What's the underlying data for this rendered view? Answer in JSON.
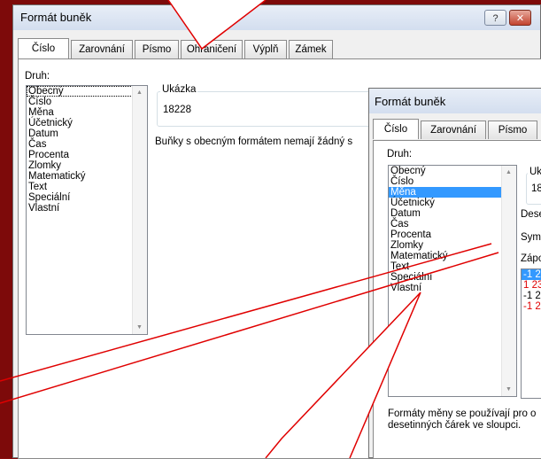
{
  "dialog1": {
    "title": "Formát buněk",
    "help_label": "?",
    "close_label": "✕",
    "tabs": [
      {
        "label": "Číslo"
      },
      {
        "label": "Zarovnání"
      },
      {
        "label": "Písmo"
      },
      {
        "label": "Ohraničení"
      },
      {
        "label": "Výplň"
      },
      {
        "label": "Zámek"
      }
    ],
    "category_label": "Druh:",
    "categories": [
      "Obecný",
      "Číslo",
      "Měna",
      "Účetnický",
      "Datum",
      "Čas",
      "Procenta",
      "Zlomky",
      "Matematický",
      "Text",
      "Speciální",
      "Vlastní"
    ],
    "sample_label": "Ukázka",
    "sample_value": "18228",
    "description": "Buňky s obecným formátem nemají žádný s"
  },
  "dialog2": {
    "title": "Formát buněk",
    "tabs": [
      {
        "label": "Číslo"
      },
      {
        "label": "Zarovnání"
      },
      {
        "label": "Písmo"
      }
    ],
    "category_label": "Druh:",
    "categories": [
      "Obecný",
      "Číslo",
      "Měna",
      "Účetnický",
      "Datum",
      "Čas",
      "Procenta",
      "Zlomky",
      "Matematický",
      "Text",
      "Speciální",
      "Vlastní"
    ],
    "sample_label": "Uká",
    "sample_value": "18",
    "decimal_label": "Dese",
    "symbol_label": "Symb",
    "negative_label": "Zápo",
    "negatives": [
      {
        "text": "-1 2",
        "color": "#ffffff"
      },
      {
        "text": "1 23",
        "color": "#e00000"
      },
      {
        "text": "-1 2",
        "color": "#000000"
      },
      {
        "text": "-1 2",
        "color": "#e00000"
      }
    ],
    "description_line1": "Formáty měny se používají pro o",
    "description_line2": "desetinných čárek ve sloupci."
  },
  "colors": {
    "selection": "#3399ff",
    "background": "#7d0a0a",
    "callout": "#e00000"
  }
}
